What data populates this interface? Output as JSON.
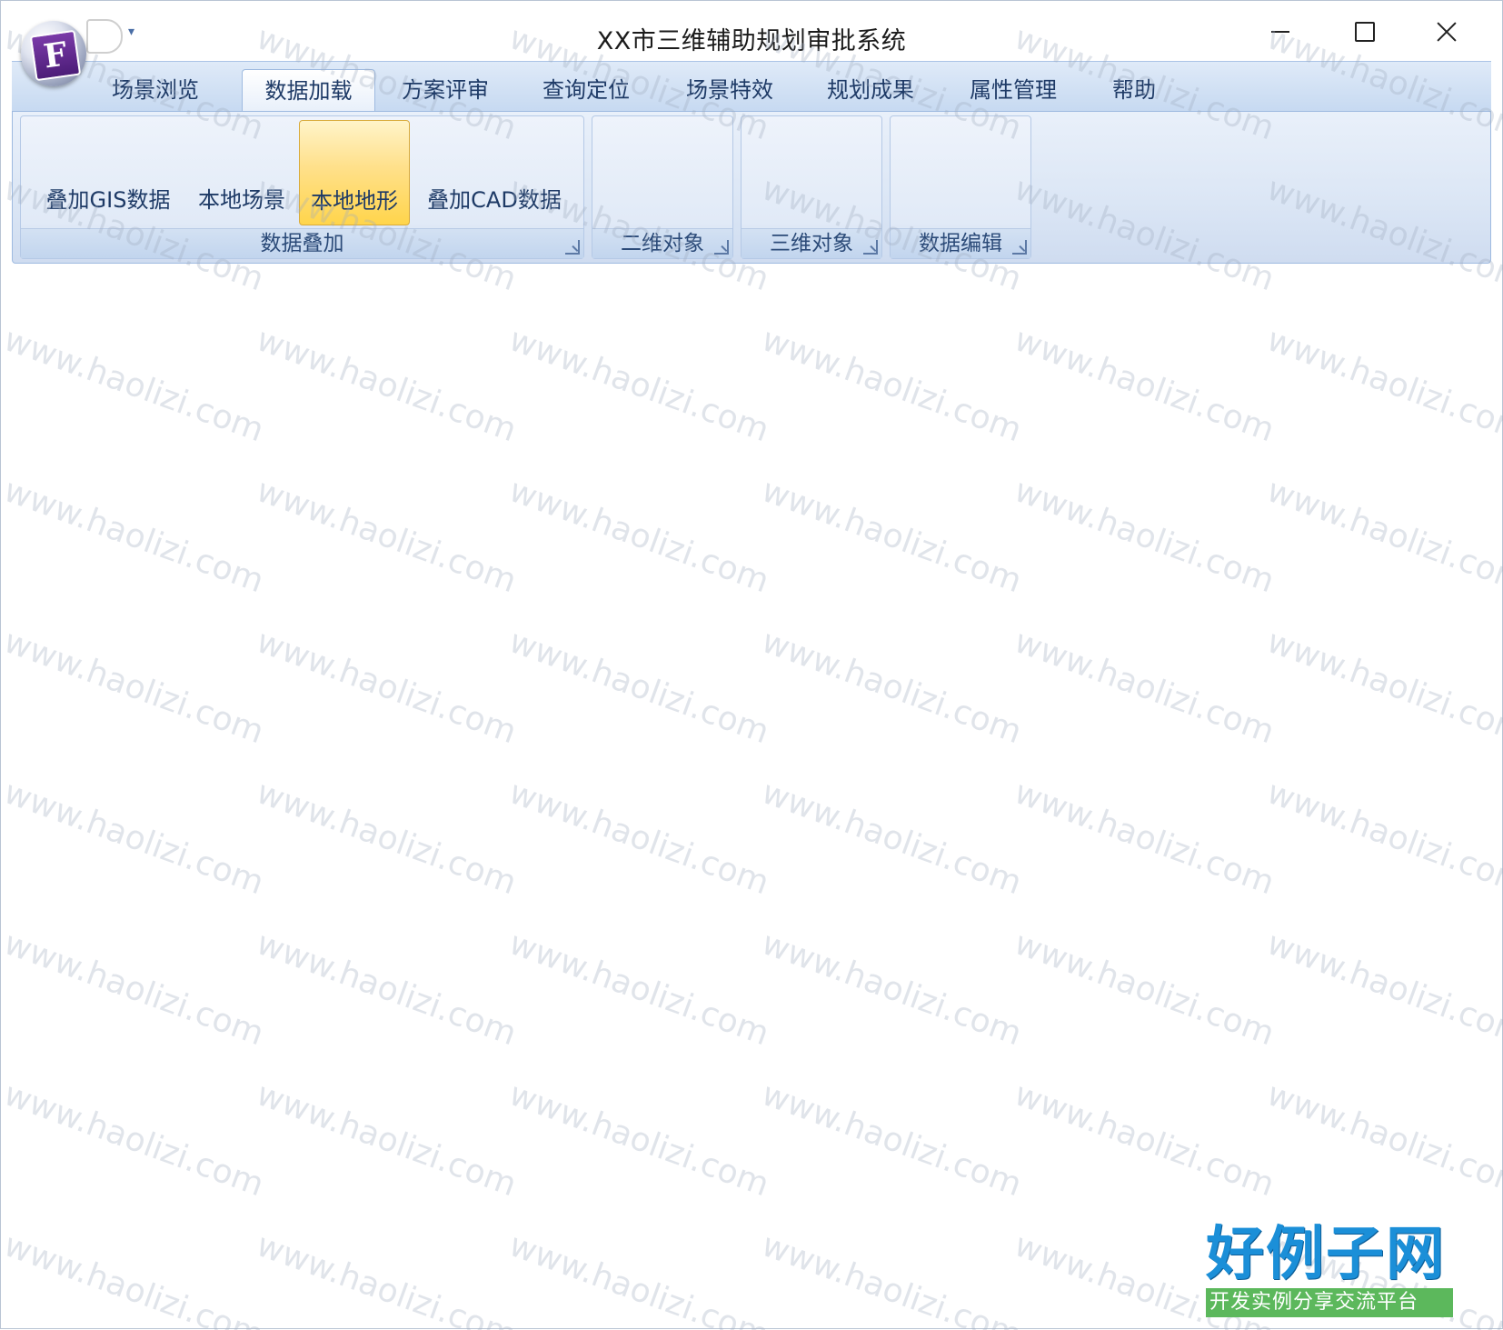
{
  "window": {
    "title": "XX市三维辅助规划审批系统"
  },
  "ribbon": {
    "tabs": [
      {
        "label": "场景浏览"
      },
      {
        "label": "数据加载",
        "active": true
      },
      {
        "label": "方案评审"
      },
      {
        "label": "查询定位"
      },
      {
        "label": "场景特效"
      },
      {
        "label": "规划成果"
      },
      {
        "label": "属性管理"
      },
      {
        "label": "帮助"
      }
    ],
    "groups": [
      {
        "caption": "数据叠加",
        "buttons": [
          {
            "label": "叠加GIS数据"
          },
          {
            "label": "本地场景"
          },
          {
            "label": "本地地形",
            "selected": true
          },
          {
            "label": "叠加CAD数据"
          }
        ]
      },
      {
        "caption": "二维对象",
        "buttons": []
      },
      {
        "caption": "三维对象",
        "buttons": []
      },
      {
        "caption": "数据编辑",
        "buttons": []
      }
    ]
  },
  "watermark": "www.haolizi.com",
  "brand": {
    "title": "好例子网",
    "subtitle": "开发实例分享交流平台"
  },
  "colors": {
    "ribbon_bg": "#c6d9f1",
    "selected_button": "#ffd54c",
    "brand_blue": "#1b8fd8",
    "brand_green": "#5cb85c"
  }
}
